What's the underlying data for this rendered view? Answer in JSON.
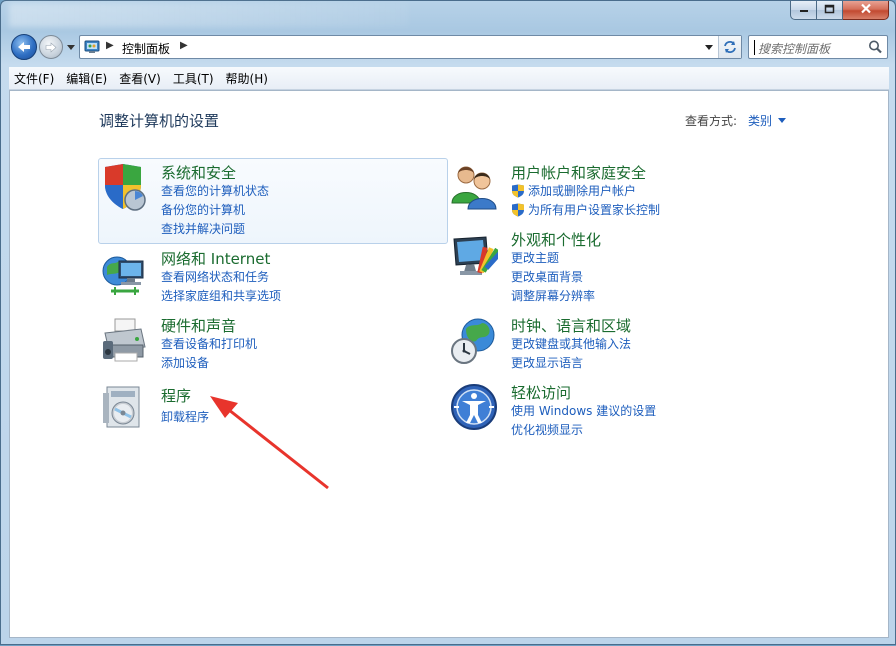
{
  "window": {
    "caption_buttons": {
      "minimize_icon": "minimize-icon",
      "maximize_icon": "maximize-icon",
      "close_icon": "close-icon"
    }
  },
  "address_bar": {
    "path": "控制面板",
    "search_placeholder": "搜索控制面板"
  },
  "menu": [
    "文件(F)",
    "编辑(E)",
    "查看(V)",
    "工具(T)",
    "帮助(H)"
  ],
  "main": {
    "title": "调整计算机的设置",
    "view_by_label": "查看方式:",
    "view_by_value": "类别"
  },
  "categories": {
    "system": {
      "title": "系统和安全",
      "icon": "shield-icon",
      "links": [
        "查看您的计算机状态",
        "备份您的计算机",
        "查找并解决问题"
      ]
    },
    "network": {
      "title": "网络和 Internet",
      "icon": "network-icon",
      "links": [
        "查看网络状态和任务",
        "选择家庭组和共享选项"
      ]
    },
    "hardware": {
      "title": "硬件和声音",
      "icon": "printer-icon",
      "links": [
        "查看设备和打印机",
        "添加设备"
      ]
    },
    "programs": {
      "title": "程序",
      "icon": "programs-icon",
      "links": [
        "卸载程序"
      ]
    },
    "users": {
      "title": "用户帐户和家庭安全",
      "icon": "users-icon",
      "links": [
        "添加或删除用户帐户",
        "为所有用户设置家长控制"
      ]
    },
    "appearance": {
      "title": "外观和个性化",
      "icon": "monitor-icon",
      "links": [
        "更改主题",
        "更改桌面背景",
        "调整屏幕分辨率"
      ]
    },
    "clock": {
      "title": "时钟、语言和区域",
      "icon": "globe-clock-icon",
      "links": [
        "更改键盘或其他输入法",
        "更改显示语言"
      ]
    },
    "ease": {
      "title": "轻松访问",
      "icon": "ease-of-access-icon",
      "links": [
        "使用 Windows 建议的设置",
        "优化视频显示"
      ]
    }
  },
  "colors": {
    "category_title": "#1a6b2f",
    "link": "#1e5ebd",
    "page_title": "#1e395b",
    "annotation_arrow": "#e8342c"
  }
}
